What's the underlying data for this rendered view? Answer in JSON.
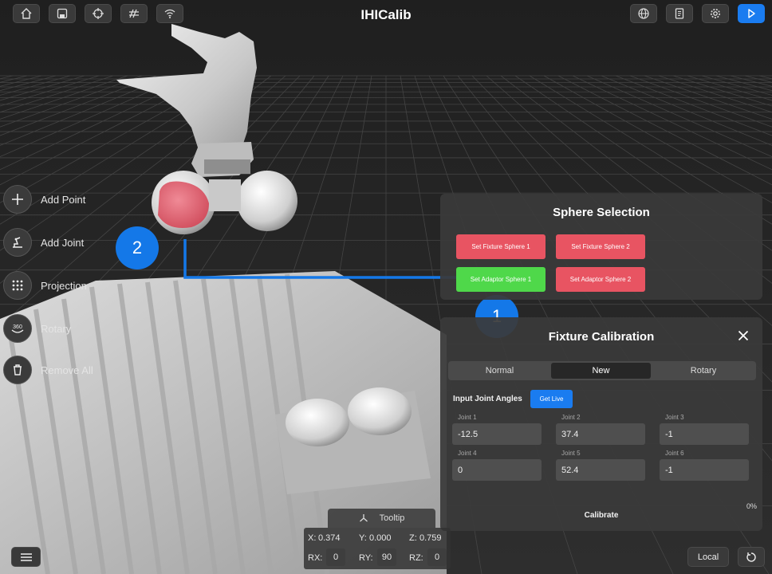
{
  "app": {
    "title": "IHICalib"
  },
  "toolbar_left": [
    {
      "icon": "home-icon"
    },
    {
      "icon": "save-icon"
    },
    {
      "icon": "crosshair-icon"
    },
    {
      "icon": "grid-icon"
    },
    {
      "icon": "wifi-icon"
    }
  ],
  "toolbar_right": [
    {
      "icon": "globe-icon"
    },
    {
      "icon": "document-icon"
    },
    {
      "icon": "gear-icon"
    },
    {
      "icon": "play-icon"
    }
  ],
  "tools": [
    {
      "label": "Add Point",
      "icon": "plus-icon"
    },
    {
      "label": "Add Joint",
      "icon": "robot-joint-icon"
    },
    {
      "label": "Projection",
      "icon": "dot-matrix-icon"
    },
    {
      "label": "Rotary",
      "icon": "rotate-360-icon",
      "icon_text": "360"
    },
    {
      "label": "Remove All",
      "icon": "trash-icon"
    }
  ],
  "callouts": {
    "first": "1",
    "second": "2"
  },
  "sphere_selection": {
    "title": "Sphere Selection",
    "buttons": [
      {
        "label": "Set Fixture Sphere 1",
        "state": "unset"
      },
      {
        "label": "Set Fixture Sphere 2",
        "state": "unset"
      },
      {
        "label": "Set Adaptor Sphere 1",
        "state": "set"
      },
      {
        "label": "Set Adaptor Sphere 2",
        "state": "unset"
      }
    ]
  },
  "fixture_calibration": {
    "title": "Fixture Calibration",
    "tabs": [
      {
        "label": "Normal",
        "active": false
      },
      {
        "label": "New",
        "active": true
      },
      {
        "label": "Rotary",
        "active": false
      }
    ],
    "input_label": "Input Joint Angles",
    "get_live_label": "Get Live",
    "joints": [
      {
        "label": "Joint 1",
        "value": "-12.5"
      },
      {
        "label": "Joint 2",
        "value": "37.4"
      },
      {
        "label": "Joint 3",
        "value": "-1"
      },
      {
        "label": "Joint 4",
        "value": "0"
      },
      {
        "label": "Joint 5",
        "value": "52.4"
      },
      {
        "label": "Joint 6",
        "value": "-1"
      }
    ],
    "calibrate_label": "Calibrate",
    "progress": "0%"
  },
  "tooltip": {
    "label": "Tooltip"
  },
  "coords": {
    "x_label": "X:",
    "x": "0.374",
    "y_label": "Y:",
    "y": "0.000",
    "z_label": "Z:",
    "z": "0.759",
    "rx_label": "RX:",
    "rx": "0",
    "ry_label": "RY:",
    "ry": "90",
    "rz_label": "RZ:",
    "rz": "0"
  },
  "bottom": {
    "frame_label": "Local"
  },
  "colors": {
    "accent": "#1a7cf0",
    "unset_sphere": "#e85462",
    "set_sphere": "#4fd84a",
    "background": "#262626"
  }
}
